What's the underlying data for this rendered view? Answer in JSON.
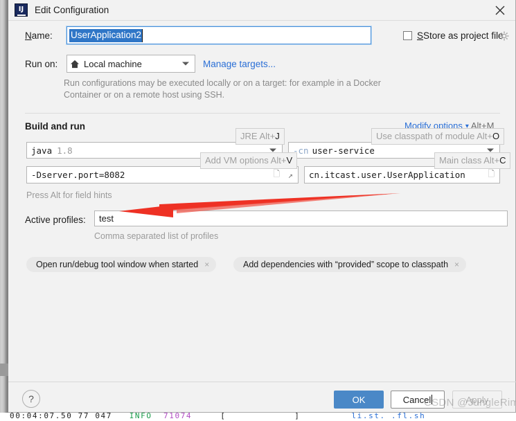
{
  "window": {
    "title": "Edit Configuration",
    "app_icon": "intellij-idea-icon",
    "close_icon": "close-icon"
  },
  "form": {
    "name_label": "Name:",
    "name_value": "UserApplication2",
    "store_as_project_file_label": "Store as project file",
    "store_gear_icon": "gear-icon",
    "run_on_label": "Run on:",
    "run_on_value": "Local machine",
    "run_on_icon": "home-icon",
    "manage_targets_link": "Manage targets...",
    "run_on_hint": "Run configurations may be executed locally or on a target: for example in a Docker Container or on a remote host using SSH."
  },
  "build_and_run": {
    "section_title": "Build and run",
    "modify_options_link": "Modify options",
    "modify_options_shortcut": "Alt+M",
    "jre_value": "java",
    "jre_version": "1.8",
    "module_prefix": "-cn",
    "module_value": "user-service",
    "vm_options_value": "-Dserver.port=8082",
    "main_class_value": "cn.itcast.user.UserApplication",
    "press_alt_hint": "Press Alt for field hints",
    "hints": [
      {
        "text": "JRE Alt+",
        "key": "J",
        "name": "jre-alt-hint"
      },
      {
        "text": "Use classpath of module Alt+",
        "key": "O",
        "name": "classpath-module-alt-hint"
      },
      {
        "text": "Add VM options Alt+",
        "key": "V",
        "name": "vm-options-alt-hint"
      },
      {
        "text": "Main class Alt+",
        "key": "C",
        "name": "main-class-alt-hint"
      }
    ]
  },
  "active_profiles": {
    "label": "Active profiles:",
    "value": "test",
    "hint": "Comma separated list of profiles"
  },
  "chips": [
    {
      "label": "Open run/debug tool window when started",
      "close": "×"
    },
    {
      "label": "Add dependencies with “provided” scope to classpath",
      "close": "×"
    }
  ],
  "footer": {
    "help_label": "?",
    "ok_label": "OK",
    "cancel_label": "Cancel",
    "apply_label": "Apply"
  },
  "watermark": "CSDN @JungleRim",
  "console": {
    "time": "00:04:07.50 77 047",
    "level": "INFO",
    "pid": "71074",
    "bracket_open": "[",
    "bracket_close": "]",
    "tail": "li.st. .fl.sh"
  },
  "colors": {
    "accent_blue": "#2a6fd6",
    "ok_button": "#4a88c7",
    "selection": "#2f76c7",
    "arrow_red": "#ee3124",
    "dialog_bg": "#f2f2f2"
  }
}
